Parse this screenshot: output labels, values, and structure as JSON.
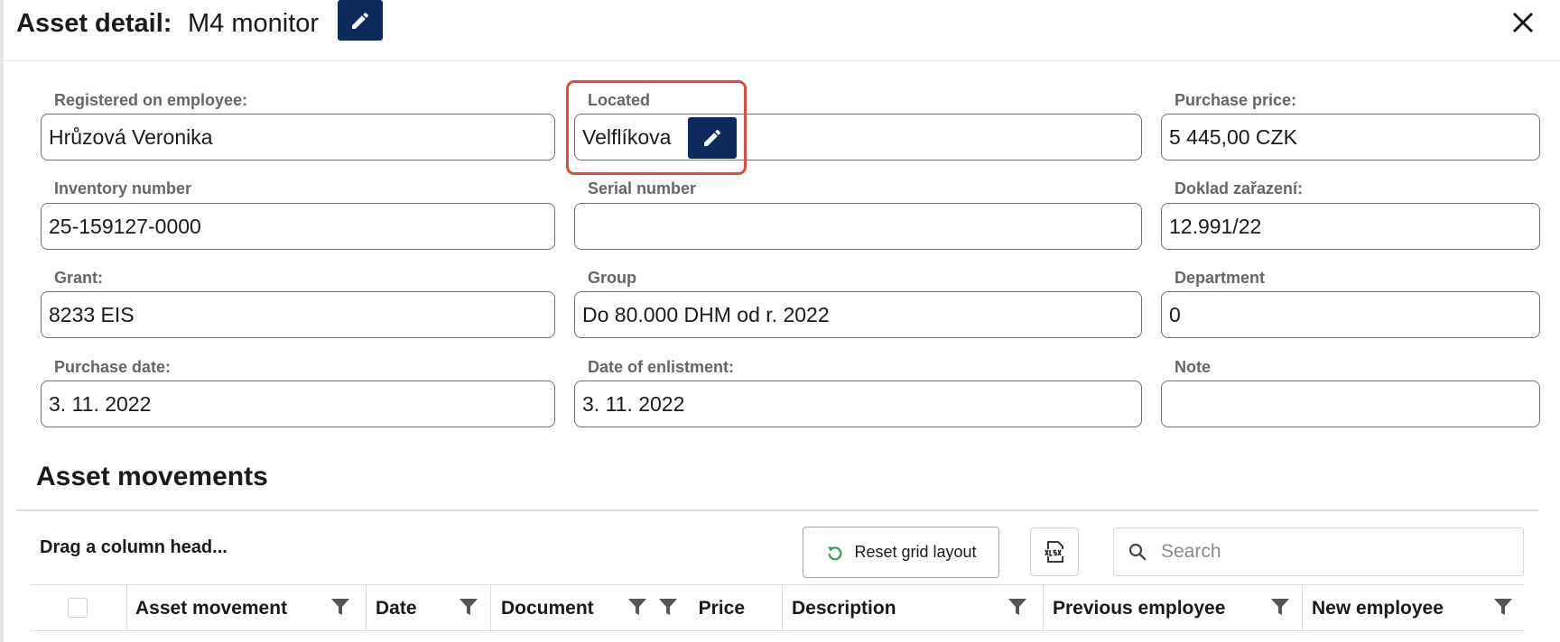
{
  "header": {
    "title_label": "Asset detail:",
    "asset_name": "M4 monitor",
    "edit_icon": "pencil-icon",
    "close_icon": "close-icon"
  },
  "fields": {
    "registered_employee": {
      "label": "Registered on employee:",
      "value": "Hrůzová Veronika"
    },
    "located": {
      "label": "Located",
      "value": "Velflíkova"
    },
    "purchase_price": {
      "label": "Purchase price:",
      "value": "5 445,00 CZK"
    },
    "inventory_number": {
      "label": "Inventory number",
      "value": "25-159127-0000"
    },
    "serial_number": {
      "label": "Serial number",
      "value": ""
    },
    "doklad": {
      "label": "Doklad zařazení:",
      "value": "12.991/22"
    },
    "grant": {
      "label": "Grant:",
      "value": "8233 EIS"
    },
    "group": {
      "label": "Group",
      "value": "Do 80.000 DHM od r. 2022"
    },
    "department": {
      "label": "Department",
      "value": "0"
    },
    "purchase_date": {
      "label": "Purchase date:",
      "value": "3. 11. 2022"
    },
    "enlistment_date": {
      "label": "Date of enlistment:",
      "value": "3. 11. 2022"
    },
    "note": {
      "label": "Note",
      "value": ""
    }
  },
  "movements": {
    "title": "Asset movements",
    "drag_hint": "Drag a column head...",
    "reset_label": "Reset grid layout",
    "export_icon": "xlsx-export-icon",
    "search_placeholder": "Search",
    "columns": [
      "Asset movement",
      "Date",
      "Document",
      "Price",
      "Description",
      "Previous employee",
      "New employee"
    ]
  },
  "colors": {
    "accent": "#0d2a5c",
    "highlight": "#e04b3f",
    "reset_icon": "#2e9e4f"
  }
}
